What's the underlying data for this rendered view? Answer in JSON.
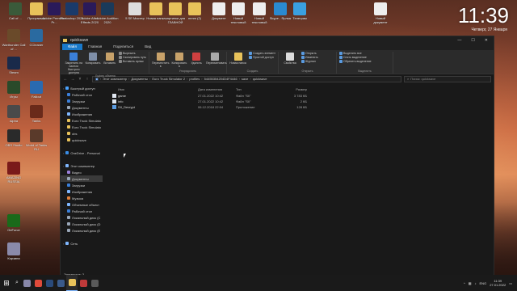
{
  "desktop": {
    "icons_top": [
      {
        "label": "Call of ..."
      },
      {
        "label": "Программы"
      },
      {
        "label": "Adobe Premiere Pr..."
      },
      {
        "label": "Photoshop 2021"
      },
      {
        "label": "Adobe After Effects 2020"
      },
      {
        "label": "Adobe Audition 2020"
      },
      {
        "label": "5 SE Мастер"
      },
      {
        "label": "Новая папка"
      },
      {
        "label": "картинки для ГЛАВНОЙ"
      },
      {
        "label": "mmm (2)"
      },
      {
        "label": "Документ"
      },
      {
        "label": "Новый текстовый"
      },
      {
        "label": "Новый текстовый"
      },
      {
        "label": "Skype - Ярлык"
      },
      {
        "label": "Телеграм"
      },
      {
        "label": "Новый документ"
      }
    ],
    "icons_left": [
      {
        "label": "Warthunder Call of ..."
      },
      {
        "label": "CCleaner"
      },
      {
        "label": "Steam"
      },
      {
        "label": "Игры"
      },
      {
        "label": "Fallout"
      },
      {
        "label": "Alpha"
      },
      {
        "label": "Tanks"
      },
      {
        "label": "OBS Studio"
      },
      {
        "label": "World of Tanks RU"
      },
      {
        "label": "AMAZING RUSSIA"
      },
      {
        "label": "GeForce"
      },
      {
        "label": "Корзина"
      }
    ],
    "clock": {
      "time": "11:39",
      "date": "Четверг, 27 Января"
    }
  },
  "window": {
    "title": "quicksave",
    "controls": [
      "—",
      "☐",
      "✕"
    ],
    "tabs": [
      "Файл",
      "Главная",
      "Поделиться",
      "Вид"
    ],
    "ribbon": {
      "clipboard": {
        "group": "Буфер обмена",
        "pin": "Закрепить на панели быстрого доступа",
        "copy": "Копировать",
        "paste": "Вставить",
        "cut": "Вырезать",
        "copy_path": "Скопировать путь",
        "paste_shortcut": "Вставить ярлык"
      },
      "organize": {
        "group": "Упорядочить",
        "move": "Переместить в",
        "copy_to": "Копировать в",
        "delete": "Удалить",
        "rename": "Переименовать"
      },
      "create": {
        "group": "Создать",
        "new_folder": "Новая папка",
        "new_item": "Создать элемент",
        "easy_access": "Простой доступ"
      },
      "open": {
        "group": "Открыть",
        "properties": "Свойства",
        "open": "Открыть",
        "edit": "Изменить",
        "history": "Журнал"
      },
      "select": {
        "group": "Выделить",
        "select_all": "Выделить все",
        "select_none": "Снять выделение",
        "invert": "Обратить выделение"
      }
    },
    "address": {
      "crumbs": [
        "Этот компьютер",
        "Документы",
        "Euro Truck Simulator 2",
        "profiles",
        "54455354204D4F4446",
        "save",
        "quicksave"
      ],
      "search_placeholder": "Поиск: quicksave"
    },
    "nav": [
      {
        "label": "Быстрый доступ",
        "sec": true,
        "color": "#4aa3ff"
      },
      {
        "label": "Рабочий стол",
        "color": "#3b7fd9"
      },
      {
        "label": "Загрузки",
        "color": "#3b7fd9"
      },
      {
        "label": "Документы",
        "color": "#9aa7b8"
      },
      {
        "label": "Изображения",
        "color": "#7fb7ff"
      },
      {
        "label": "Euro Truck Simulato",
        "color": "#e8c25a"
      },
      {
        "label": "Euro Truck Simulato",
        "color": "#e8c25a"
      },
      {
        "label": "obs",
        "color": "#e8c25a"
      },
      {
        "label": "quicksave",
        "color": "#e8c25a"
      },
      {
        "label": "",
        "color": "transparent"
      },
      {
        "label": "OneDrive - Personal",
        "sec": true,
        "color": "#3a8ee6"
      },
      {
        "label": "",
        "color": "transparent"
      },
      {
        "label": "Этот компьютер",
        "sec": true,
        "color": "#7fb7ff"
      },
      {
        "label": "Видео",
        "color": "#9a7fd9"
      },
      {
        "label": "Документы",
        "color": "#9aa7b8",
        "sel": true
      },
      {
        "label": "Загрузки",
        "color": "#3b7fd9"
      },
      {
        "label": "Изображения",
        "color": "#7fb7ff"
      },
      {
        "label": "Музыка",
        "color": "#e07f3a"
      },
      {
        "label": "Объемные объект",
        "color": "#7fb7ff"
      },
      {
        "label": "Рабочий стол",
        "color": "#3b7fd9"
      },
      {
        "label": "Локальный диск (C",
        "color": "#9aa7b8"
      },
      {
        "label": "Локальный диск (D",
        "color": "#9aa7b8"
      },
      {
        "label": "Локальный диск (E",
        "color": "#9aa7b8"
      },
      {
        "label": "",
        "color": "transparent"
      },
      {
        "label": "Сеть",
        "sec": true,
        "color": "#7fb7ff"
      }
    ],
    "columns": {
      "name": "Имя",
      "date": "Дата изменения",
      "type": "Тип",
      "size": "Размер"
    },
    "files": [
      {
        "name": "game",
        "date": "27.01.2022 10:42",
        "type": "Файл \"SII\"",
        "size": "3 783 КБ"
      },
      {
        "name": "info",
        "date": "27.01.2022 10:42",
        "type": "Файл \"SII\"",
        "size": "2 КБ"
      },
      {
        "name": "SII_Decrypt",
        "date": "06.12.2018 22:04",
        "type": "Приложение",
        "size": "128 КБ"
      }
    ],
    "status": "Элементов: 3"
  },
  "taskbar": {
    "start": "⊞",
    "search": "⌕",
    "apps": [
      {
        "name": "task-view",
        "color": "#8888aa"
      },
      {
        "name": "yandex",
        "color": "#e04a3a"
      },
      {
        "name": "steam",
        "color": "#2a4a7a"
      },
      {
        "name": "steam-2",
        "color": "#3a5a8a"
      },
      {
        "name": "explorer",
        "color": "#e8c25a",
        "active": true
      },
      {
        "name": "app-1",
        "color": "#c03a3a"
      },
      {
        "name": "app-2",
        "color": "#5a5a5a"
      }
    ],
    "tray": {
      "lang": "ENG",
      "time": "11:39",
      "date": "27.01.2022"
    }
  }
}
